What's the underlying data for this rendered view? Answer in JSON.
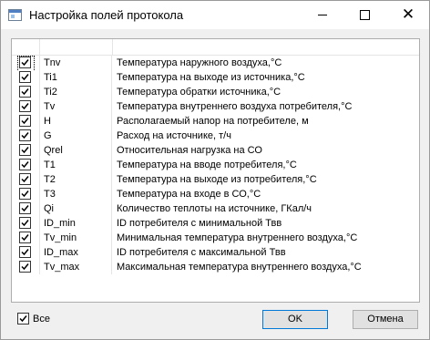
{
  "window": {
    "title": "Настройка полей протокола",
    "icon": "dialog-window-icon"
  },
  "titlebar_buttons": {
    "minimize": "minimize-icon",
    "maximize": "maximize-icon",
    "close": "close-icon"
  },
  "table": {
    "columns": [
      "",
      "",
      ""
    ],
    "rows": [
      {
        "checked": true,
        "code": "Tnv",
        "description": "Температура наружного воздуха,°C"
      },
      {
        "checked": true,
        "code": "Ti1",
        "description": "Температура на выходе из источника,°C"
      },
      {
        "checked": true,
        "code": "Ti2",
        "description": "Температура обратки источника,°C"
      },
      {
        "checked": true,
        "code": "Tv",
        "description": "Температура внутреннего воздуха потребителя,°C"
      },
      {
        "checked": true,
        "code": "H",
        "description": "Располагаемый напор на потребителе, м"
      },
      {
        "checked": true,
        "code": "G",
        "description": "Расход на источнике, т/ч"
      },
      {
        "checked": true,
        "code": "Qrel",
        "description": "Относительная нагрузка на СО"
      },
      {
        "checked": true,
        "code": "T1",
        "description": "Температура на вводе потребителя,°C"
      },
      {
        "checked": true,
        "code": "T2",
        "description": "Температура на выходе из потребителя,°C"
      },
      {
        "checked": true,
        "code": "T3",
        "description": "Температура на входе в СО,°C"
      },
      {
        "checked": true,
        "code": "Qi",
        "description": "Количество теплоты на источнике, ГКал/ч"
      },
      {
        "checked": true,
        "code": "ID_min",
        "description": "ID потребителя с минимальной Твв"
      },
      {
        "checked": true,
        "code": "Tv_min",
        "description": "Минимальная температура внутреннего воздуха,°C"
      },
      {
        "checked": true,
        "code": "ID_max",
        "description": "ID потребителя с максимальной Твв"
      },
      {
        "checked": true,
        "code": "Tv_max",
        "description": "Максимальная температура внутреннего воздуха,°C"
      }
    ]
  },
  "select_all": {
    "label": "Все",
    "checked": true
  },
  "buttons": {
    "ok": "OK",
    "cancel": "Отмена"
  },
  "colors": {
    "accent": "#0078d7",
    "window_bg": "#f0f0f0",
    "grid_line": "#e5e5e5"
  }
}
